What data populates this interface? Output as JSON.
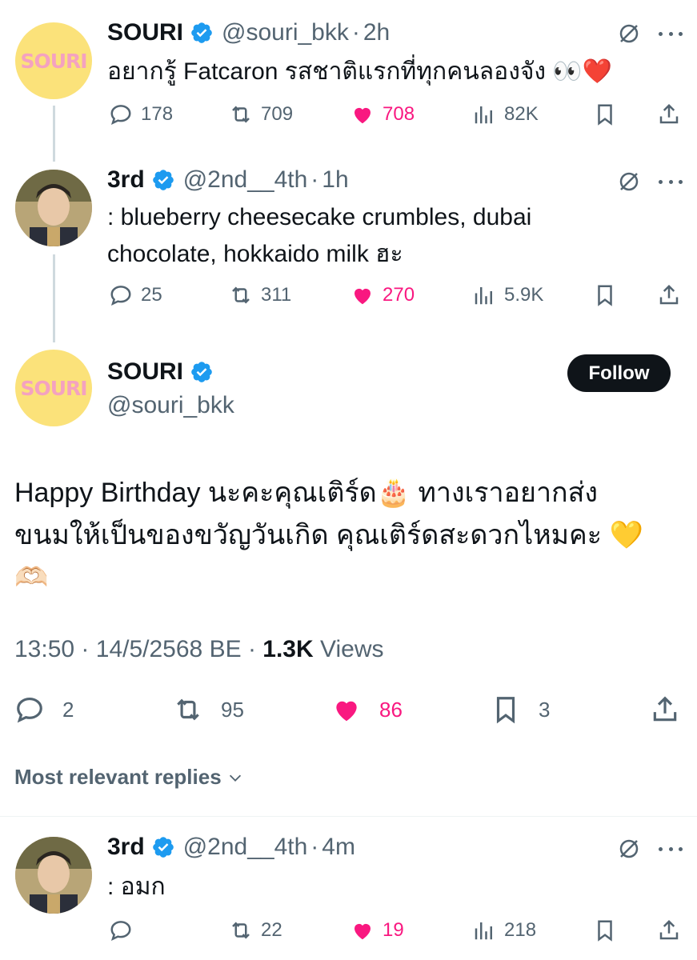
{
  "tweets": [
    {
      "name": "SOURI",
      "handle": "@souri_bkk",
      "sep": "·",
      "time": "2h",
      "text": "อยากรู้ Fatcaron รสชาติแรกที่ทุกคนลองจัง 👀❤️",
      "avatar_text": "SOURI",
      "replies": "178",
      "reposts": "709",
      "likes": "708",
      "views": "82K"
    },
    {
      "name": "3rd",
      "handle": "@2nd__4th",
      "sep": "·",
      "time": "1h",
      "text_line1": ": blueberry cheesecake crumbles, dubai",
      "text_line2": "chocolate, hokkaido milk ฮะ",
      "replies": "25",
      "reposts": "311",
      "likes": "270",
      "views": "5.9K"
    }
  ],
  "main": {
    "name": "SOURI",
    "handle": "@souri_bkk",
    "avatar_text": "SOURI",
    "follow_label": "Follow",
    "text_line1": "Happy Birthday นะคะคุณเติร์ด🎂 ทางเราอยากส่ง",
    "text_line2": "ขนมให้เป็นของขวัญวันเกิด คุณเติร์ดสะดวกไหมคะ 💛",
    "text_line3": "🫶🏻",
    "time": "13:50",
    "date": "14/5/2568 BE",
    "views_count": "1.3K",
    "views_label": "Views",
    "sep": "·",
    "replies": "2",
    "reposts": "95",
    "likes": "86",
    "bookmarks": "3"
  },
  "replies_section": {
    "sort_label": "Most relevant replies"
  },
  "reply": {
    "name": "3rd",
    "handle": "@2nd__4th",
    "sep": "·",
    "time": "4m",
    "text": ": อมก",
    "replies": "",
    "reposts": "22",
    "likes": "19",
    "views": "218"
  },
  "colors": {
    "like": "#f91880",
    "verified": "#1d9bf0",
    "secondary_text": "#536471",
    "souri_avatar_bg": "#fbe27a",
    "souri_avatar_text": "#f4a2c0",
    "follow_button_bg": "#0f1419"
  }
}
